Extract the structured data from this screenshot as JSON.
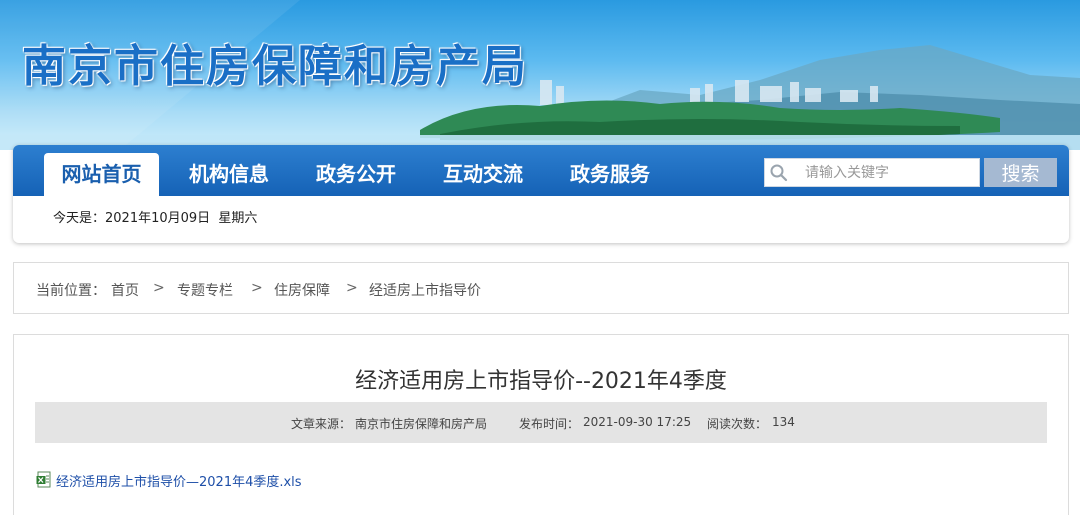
{
  "header": {
    "site_title": "南京市住房保障和房产局"
  },
  "nav": {
    "items": [
      {
        "label": "网站首页",
        "active": true
      },
      {
        "label": "机构信息",
        "active": false
      },
      {
        "label": "政务公开",
        "active": false
      },
      {
        "label": "互动交流",
        "active": false
      },
      {
        "label": "政务服务",
        "active": false
      }
    ],
    "search": {
      "placeholder": "请输入关键字",
      "button_label": "搜索"
    },
    "date_text": "今天是：2021年10月09日  星期六"
  },
  "breadcrumb": {
    "prefix": "当前位置：",
    "items": [
      "首页",
      "专题专栏",
      "住房保障",
      "经适房上市指导价"
    ],
    "separator": ">"
  },
  "article": {
    "title": "经济适用房上市指导价--2021年4季度",
    "source_label": "文章来源：",
    "source": "南京市住房保障和房产局",
    "published_label": "发布时间：",
    "published": "2021-09-30 17:25",
    "views_label": "阅读次数：",
    "views": "134",
    "attachment": "经济适用房上市指导价—2021年4季度.xls"
  },
  "colors": {
    "nav_blue": "#1a66b8",
    "link_blue": "#1e4fa8",
    "title_blue": "#1a6fc6"
  }
}
